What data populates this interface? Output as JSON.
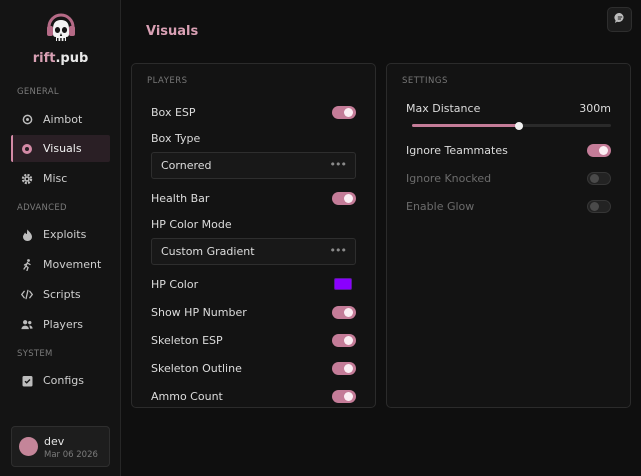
{
  "app": {
    "brand_prefix": "rift",
    "brand_suffix": ".pub"
  },
  "sidebar": {
    "sections": [
      {
        "label": "GENERAL"
      },
      {
        "label": "ADVANCED"
      },
      {
        "label": "SYSTEM"
      }
    ],
    "items": [
      {
        "label": "Aimbot",
        "icon": "crosshair-icon",
        "active": false
      },
      {
        "label": "Visuals",
        "icon": "eye-icon",
        "active": true
      },
      {
        "label": "Misc",
        "icon": "gear-icon",
        "active": false
      },
      {
        "label": "Exploits",
        "icon": "flame-icon",
        "active": false
      },
      {
        "label": "Movement",
        "icon": "running-icon",
        "active": false
      },
      {
        "label": "Scripts",
        "icon": "code-icon",
        "active": false
      },
      {
        "label": "Players",
        "icon": "users-icon",
        "active": false
      },
      {
        "label": "Configs",
        "icon": "clipboard-icon",
        "active": false
      }
    ]
  },
  "user": {
    "name": "dev",
    "date": "Mar 06 2026"
  },
  "header": {
    "title": "Visuals",
    "action_icon": "chat-bubble-icon"
  },
  "players_panel": {
    "label": "PLAYERS",
    "box_esp": {
      "label": "Box ESP",
      "enabled": true
    },
    "box_type": {
      "label": "Box Type",
      "value": "Cornered"
    },
    "health_bar": {
      "label": "Health Bar",
      "enabled": true
    },
    "hp_color_mode": {
      "label": "HP Color Mode",
      "value": "Custom Gradient"
    },
    "hp_color": {
      "label": "HP Color",
      "color": "#8a00ff"
    },
    "show_hp_number": {
      "label": "Show HP Number",
      "enabled": true
    },
    "skeleton_esp": {
      "label": "Skeleton ESP",
      "enabled": true
    },
    "skeleton_outline": {
      "label": "Skeleton Outline",
      "enabled": true
    },
    "ammo_count": {
      "label": "Ammo Count",
      "enabled": true
    }
  },
  "settings_panel": {
    "label": "SETTINGS",
    "max_distance": {
      "label": "Max Distance",
      "value_text": "300m",
      "fraction": 0.54
    },
    "ignore_teammates": {
      "label": "Ignore Teammates",
      "enabled": true
    },
    "ignore_knocked": {
      "label": "Ignore Knocked",
      "enabled": false
    },
    "enable_glow": {
      "label": "Enable Glow",
      "enabled": false
    }
  },
  "colors": {
    "accent": "#d9a0b4",
    "toggle_on": "#c47c98"
  }
}
